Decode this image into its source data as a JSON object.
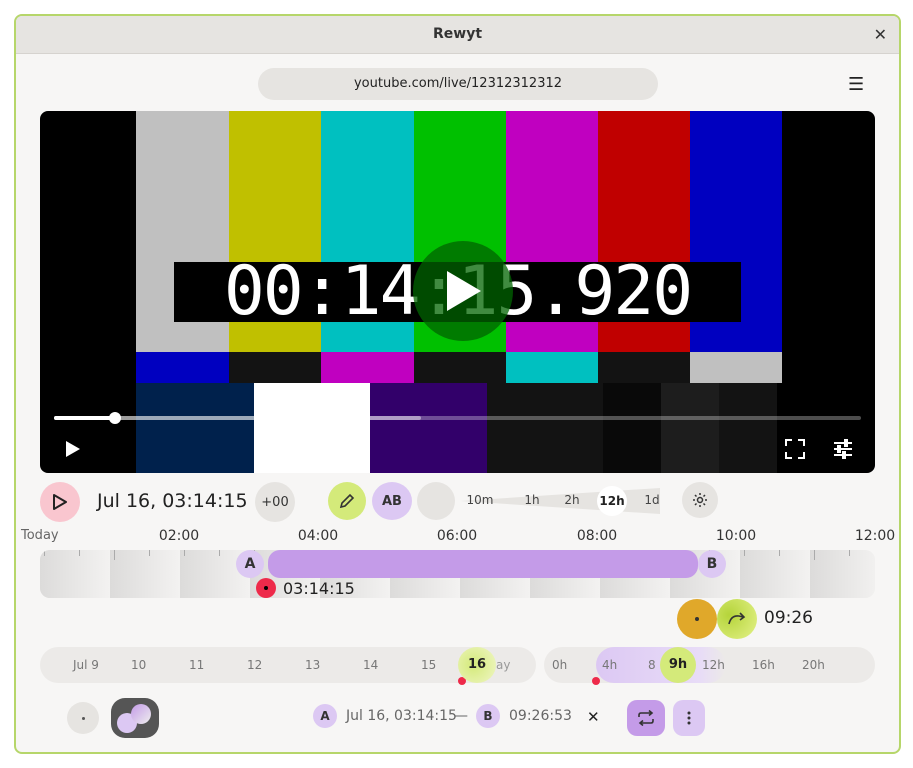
{
  "window": {
    "title": "Rewyt"
  },
  "address": {
    "url": "youtube.com/live/12312312312"
  },
  "video": {
    "timecode": "00:14:15.920",
    "progress_fraction": 0.075,
    "buffer_fraction": 0.455,
    "colors": {
      "top": [
        "#c0c0c0",
        "#c0c000",
        "#00c0c0",
        "#00c000",
        "#c000c0",
        "#c00000",
        "#0000c0"
      ],
      "mid": [
        "#0000c0",
        "#131313",
        "#c000c0",
        "#131313",
        "#00c0c0",
        "#131313",
        "#c0c0c0"
      ],
      "bottom": [
        "#00214c",
        "#ffffff",
        "#32006a",
        "#131313",
        "#090909",
        "#1d1d1d",
        "#131313"
      ]
    }
  },
  "controls": {
    "datetime": "Jul 16, 03:14:15",
    "offset_label": "+00",
    "ab_label": "AB",
    "zoom_levels": [
      "10m",
      "1h",
      "2h",
      "12h",
      "1d"
    ],
    "zoom_selected": "12h"
  },
  "timeline": {
    "today_label": "Today",
    "hour_labels": [
      "02:00",
      "04:00",
      "06:00",
      "08:00",
      "10:00",
      "12:00"
    ],
    "marker_a": "A",
    "marker_b": "B",
    "playhead_time": "03:14:15",
    "jump_time": "09:26"
  },
  "days": {
    "labels": [
      "Jul 9",
      "10",
      "11",
      "12",
      "13",
      "14",
      "15",
      "16"
    ],
    "selected": "16",
    "trailing_label": "ay"
  },
  "hours": {
    "labels": [
      "0h",
      "4h",
      "8",
      "9h",
      "12h",
      "16h",
      "20h"
    ],
    "selected": "9h"
  },
  "footer": {
    "marker_a": "A",
    "range_start": "Jul 16, 03:14:15",
    "dash": "—",
    "marker_b": "B",
    "range_end": "09:26:53",
    "clear": "✕"
  },
  "accent": {
    "lime": "#d4ea7a",
    "purple": "#c49be8",
    "pink": "#f9c6cf",
    "gold": "#e0a82a",
    "red": "#ee2a4a"
  }
}
